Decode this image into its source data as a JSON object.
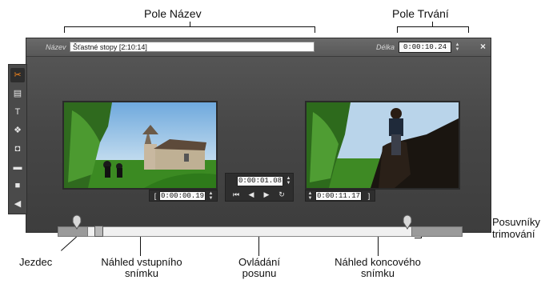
{
  "callouts": {
    "name_field": "Pole Název",
    "duration_field": "Pole Trvání",
    "trim_sliders": "Posuvníky\ntrimování",
    "scrubber": "Jezdec",
    "in_preview": "Náhled vstupního\nsnímku",
    "shuttle": "Ovládání\nposunu",
    "out_preview": "Náhled koncového\nsnímku"
  },
  "editor": {
    "name_label": "Název",
    "name_value": "Šťastné stopy [2:10:14]",
    "duration_label": "Délka",
    "duration_value": "0:00:10.24",
    "close_glyph": "×"
  },
  "sidebar": {
    "items": [
      {
        "icon": "scissors-icon",
        "glyph": "✂",
        "active": true
      },
      {
        "icon": "clip-properties-icon",
        "glyph": "▤",
        "active": false
      },
      {
        "icon": "title-icon",
        "glyph": "T",
        "active": false
      },
      {
        "icon": "effects-icon",
        "glyph": "❖",
        "active": false
      },
      {
        "icon": "snapshot-icon",
        "glyph": "◘",
        "active": false
      },
      {
        "icon": "frame-icon",
        "glyph": "▬",
        "active": false
      },
      {
        "icon": "record-icon",
        "glyph": "■",
        "active": false
      },
      {
        "icon": "audio-icon",
        "glyph": "◀",
        "active": false
      }
    ]
  },
  "in_frame": {
    "bracket": "[",
    "timecode": "0:00:00.19"
  },
  "shuttle": {
    "timecode": "0:00:01.08",
    "buttons": [
      {
        "icon": "go-to-start-icon",
        "glyph": "⏮"
      },
      {
        "icon": "step-back-icon",
        "glyph": "◀"
      },
      {
        "icon": "play-icon",
        "glyph": "▶"
      },
      {
        "icon": "loop-icon",
        "glyph": "↻"
      }
    ]
  },
  "out_frame": {
    "bracket": "]",
    "timecode": "0:00:11.17"
  },
  "colors": {
    "active_tool": "#ff8a1c"
  }
}
